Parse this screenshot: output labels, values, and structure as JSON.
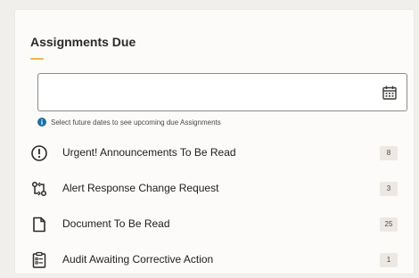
{
  "widget": {
    "title": "Assignments Due"
  },
  "date_filter": {
    "value": "",
    "placeholder": "",
    "hint": "Select future dates to see upcoming due Assignments",
    "hint_icon": "info-icon",
    "picker_icon": "calendar-icon"
  },
  "items": [
    {
      "label": "Urgent! Announcements To Be Read",
      "count": "8",
      "icon": "alert-circle-icon"
    },
    {
      "label": "Alert Response Change Request",
      "count": "3",
      "icon": "change-request-icon"
    },
    {
      "label": "Document To Be Read",
      "count": "25",
      "icon": "document-icon"
    },
    {
      "label": "Audit Awaiting Corrective Action",
      "count": "1",
      "icon": "audit-clipboard-icon"
    }
  ],
  "colors": {
    "accent": "#e8b84a",
    "info": "#1f6fa3",
    "badge_bg": "#ede8e1"
  }
}
